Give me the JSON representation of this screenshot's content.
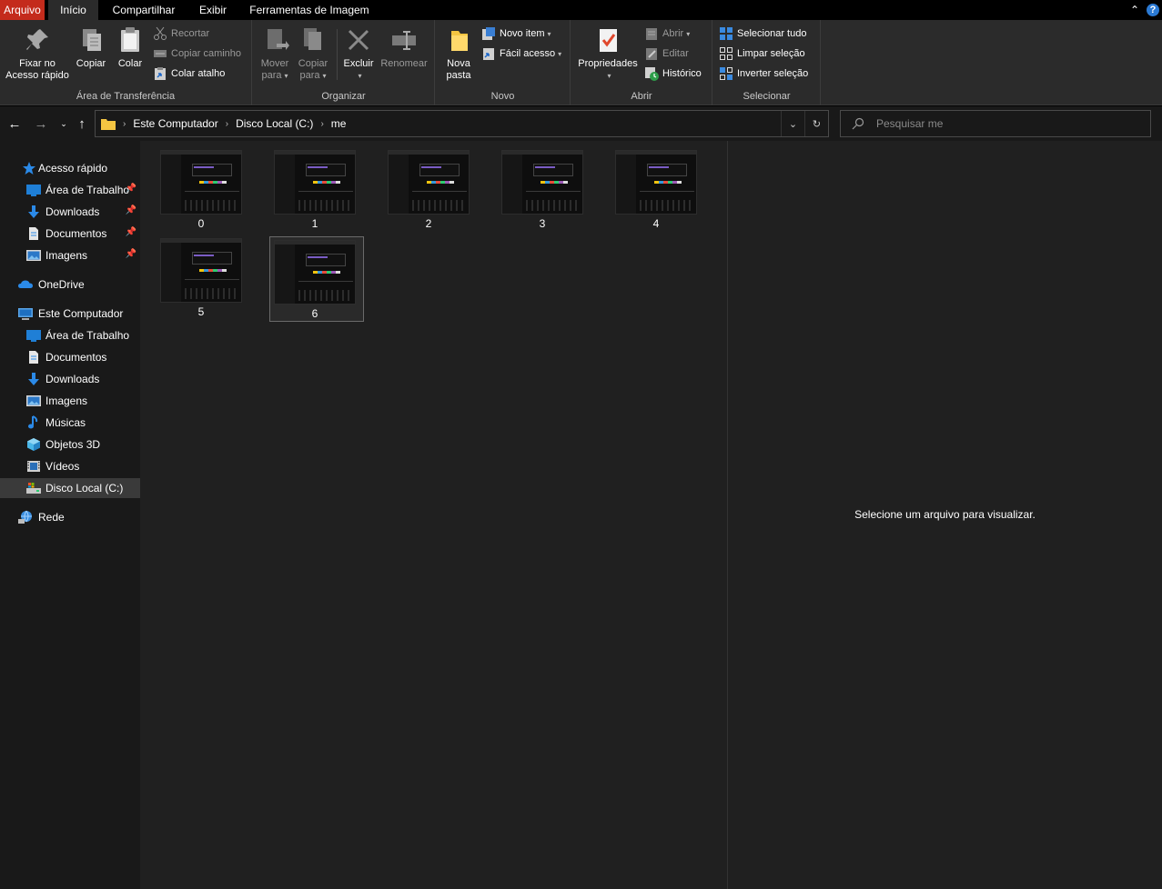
{
  "tabs": {
    "file": "Arquivo",
    "home": "Início",
    "share": "Compartilhar",
    "view": "Exibir",
    "image_tools": "Ferramentas de Imagem"
  },
  "ribbon": {
    "clipboard": {
      "label": "Área de Transferência",
      "pin_line1": "Fixar no",
      "pin_line2": "Acesso rápido",
      "copy": "Copiar",
      "paste": "Colar",
      "cut": "Recortar",
      "copy_path": "Copiar caminho",
      "paste_shortcut": "Colar atalho"
    },
    "organize": {
      "label": "Organizar",
      "move_line1": "Mover",
      "move_line2": "para",
      "copy_line1": "Copiar",
      "copy_line2": "para",
      "delete": "Excluir",
      "rename": "Renomear"
    },
    "new": {
      "label": "Novo",
      "folder_line1": "Nova",
      "folder_line2": "pasta",
      "new_item": "Novo item",
      "easy_access": "Fácil acesso"
    },
    "open": {
      "label": "Abrir",
      "properties": "Propriedades",
      "open": "Abrir",
      "edit": "Editar",
      "history": "Histórico"
    },
    "select": {
      "label": "Selecionar",
      "select_all": "Selecionar tudo",
      "select_none": "Limpar seleção",
      "invert": "Inverter seleção"
    }
  },
  "address": {
    "crumbs": [
      "Este Computador",
      "Disco Local (C:)",
      "me"
    ]
  },
  "search": {
    "placeholder": "Pesquisar me"
  },
  "sidebar": {
    "quick_access": "Acesso rápido",
    "quick_items": [
      "Área de Trabalho",
      "Downloads",
      "Documentos",
      "Imagens"
    ],
    "onedrive": "OneDrive",
    "this_pc": "Este Computador",
    "pc_items": [
      "Área de Trabalho",
      "Documentos",
      "Downloads",
      "Imagens",
      "Músicas",
      "Objetos 3D",
      "Vídeos",
      "Disco Local (C:)"
    ],
    "network": "Rede"
  },
  "files": [
    "0",
    "1",
    "2",
    "3",
    "4",
    "5",
    "6"
  ],
  "selected_file": "6",
  "preview": {
    "message": "Selecione um arquivo para visualizar."
  },
  "colors": {
    "file_tab": "#c42b1c",
    "accent_blue": "#2b7ad4",
    "folder_yellow": "#f4c542"
  }
}
